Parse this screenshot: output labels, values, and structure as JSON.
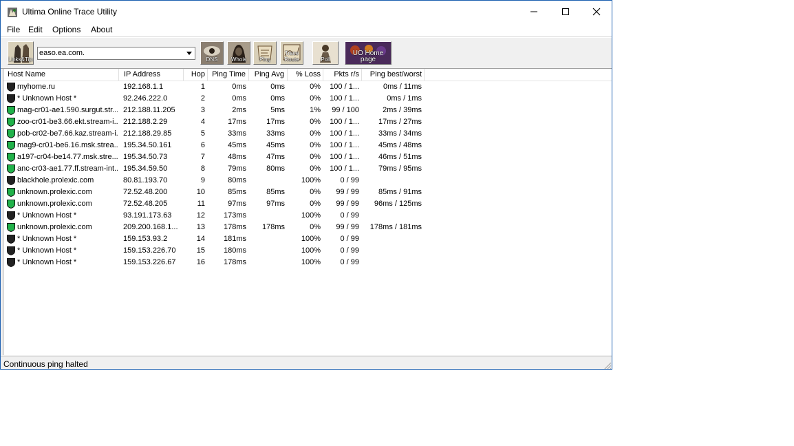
{
  "window": {
    "title": "Ultima Online Trace Utility"
  },
  "menu": [
    "File",
    "Edit",
    "Options",
    "About"
  ],
  "toolbar": {
    "host_value": "easo.ea.com.",
    "buttons": [
      {
        "name": "links-button",
        "label": "Links&Tips"
      },
      {
        "name": "dns-button",
        "label": "DNS"
      },
      {
        "name": "whois-button",
        "label": "Whois"
      },
      {
        "name": "ping-button",
        "label": "Ping"
      },
      {
        "name": "trace-route-button",
        "label": "Trace Route"
      },
      {
        "name": "poll-button",
        "label": "Poll"
      },
      {
        "name": "uo-home-page-button",
        "label": "UO Home page"
      }
    ]
  },
  "table": {
    "columns": [
      "Host Name",
      "IP Address",
      "Hop",
      "Ping Time",
      "Ping Avg",
      "% Loss",
      "Pkts r/s",
      "Ping best/worst"
    ],
    "rows": [
      {
        "status": "black",
        "host": "myhome.ru",
        "ip": "192.168.1.1",
        "hop": "1",
        "time": "0ms",
        "avg": "0ms",
        "loss": "0%",
        "pkts": "100 / 1...",
        "bw": "0ms / 11ms"
      },
      {
        "status": "black",
        "host": "* Unknown Host *",
        "ip": "92.246.222.0",
        "hop": "2",
        "time": "0ms",
        "avg": "0ms",
        "loss": "0%",
        "pkts": "100 / 1...",
        "bw": "0ms / 1ms"
      },
      {
        "status": "green",
        "host": "mag-cr01-ae1.590.surgut.str...",
        "ip": "212.188.11.205",
        "hop": "3",
        "time": "2ms",
        "avg": "5ms",
        "loss": "1%",
        "pkts": "99 / 100",
        "bw": "2ms / 39ms"
      },
      {
        "status": "green",
        "host": "zoo-cr01-be3.66.ekt.stream-i...",
        "ip": "212.188.2.29",
        "hop": "4",
        "time": "17ms",
        "avg": "17ms",
        "loss": "0%",
        "pkts": "100 / 1...",
        "bw": "17ms / 27ms"
      },
      {
        "status": "green",
        "host": "pob-cr02-be7.66.kaz.stream-i...",
        "ip": "212.188.29.85",
        "hop": "5",
        "time": "33ms",
        "avg": "33ms",
        "loss": "0%",
        "pkts": "100 / 1...",
        "bw": "33ms / 34ms"
      },
      {
        "status": "green",
        "host": "mag9-cr01-be6.16.msk.strea...",
        "ip": "195.34.50.161",
        "hop": "6",
        "time": "45ms",
        "avg": "45ms",
        "loss": "0%",
        "pkts": "100 / 1...",
        "bw": "45ms / 48ms"
      },
      {
        "status": "green",
        "host": "a197-cr04-be14.77.msk.stre...",
        "ip": "195.34.50.73",
        "hop": "7",
        "time": "48ms",
        "avg": "47ms",
        "loss": "0%",
        "pkts": "100 / 1...",
        "bw": "46ms / 51ms"
      },
      {
        "status": "green",
        "host": "anc-cr03-ae1.77.ff.stream-int...",
        "ip": "195.34.59.50",
        "hop": "8",
        "time": "79ms",
        "avg": "80ms",
        "loss": "0%",
        "pkts": "100 / 1...",
        "bw": "79ms / 95ms"
      },
      {
        "status": "black",
        "host": "blackhole.prolexic.com",
        "ip": "80.81.193.70",
        "hop": "9",
        "time": "80ms",
        "avg": "",
        "loss": "100%",
        "pkts": "0 / 99",
        "bw": ""
      },
      {
        "status": "green",
        "host": "unknown.prolexic.com",
        "ip": "72.52.48.200",
        "hop": "10",
        "time": "85ms",
        "avg": "85ms",
        "loss": "0%",
        "pkts": "99 / 99",
        "bw": "85ms / 91ms"
      },
      {
        "status": "green",
        "host": "unknown.prolexic.com",
        "ip": "72.52.48.205",
        "hop": "11",
        "time": "97ms",
        "avg": "97ms",
        "loss": "0%",
        "pkts": "99 / 99",
        "bw": "96ms / 125ms"
      },
      {
        "status": "black",
        "host": "* Unknown Host *",
        "ip": "93.191.173.63",
        "hop": "12",
        "time": "173ms",
        "avg": "",
        "loss": "100%",
        "pkts": "0 / 99",
        "bw": ""
      },
      {
        "status": "green",
        "host": "unknown.prolexic.com",
        "ip": "209.200.168.1...",
        "hop": "13",
        "time": "178ms",
        "avg": "178ms",
        "loss": "0%",
        "pkts": "99 / 99",
        "bw": "178ms / 181ms"
      },
      {
        "status": "black",
        "host": "* Unknown Host *",
        "ip": "159.153.93.2",
        "hop": "14",
        "time": "181ms",
        "avg": "",
        "loss": "100%",
        "pkts": "0 / 99",
        "bw": ""
      },
      {
        "status": "black",
        "host": "* Unknown Host *",
        "ip": "159.153.226.70",
        "hop": "15",
        "time": "180ms",
        "avg": "",
        "loss": "100%",
        "pkts": "0 / 99",
        "bw": ""
      },
      {
        "status": "black",
        "host": "* Unknown Host *",
        "ip": "159.153.226.67",
        "hop": "16",
        "time": "178ms",
        "avg": "",
        "loss": "100%",
        "pkts": "0 / 99",
        "bw": ""
      }
    ]
  },
  "status_bar": {
    "text": "Continuous ping halted"
  },
  "colors": {
    "reply_ok": "#21b24a",
    "no_reply": "#222222",
    "title_border": "#1b5fb0"
  }
}
